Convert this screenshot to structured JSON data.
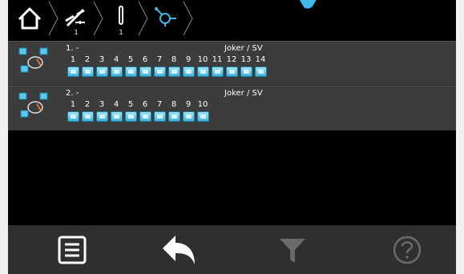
{
  "breadcrumb": {
    "items": [
      {
        "icon": "home-icon",
        "sub": ""
      },
      {
        "icon": "disconnect-icon",
        "sub": "1"
      },
      {
        "icon": "sensor-probe-icon",
        "sub": "1"
      },
      {
        "icon": "network-node-icon",
        "sub": ""
      }
    ]
  },
  "groups": [
    {
      "title": "1. -",
      "owner": "Joker / SV",
      "numbers": [
        "1",
        "2",
        "3",
        "4",
        "5",
        "6",
        "7",
        "8",
        "9",
        "10",
        "11",
        "12",
        "13",
        "14"
      ]
    },
    {
      "title": "2. -",
      "owner": "Joker / SV",
      "numbers": [
        "1",
        "2",
        "3",
        "4",
        "5",
        "6",
        "7",
        "8",
        "9",
        "10"
      ]
    }
  ],
  "toolbar": {
    "items": [
      {
        "icon": "list-icon",
        "enabled": true
      },
      {
        "icon": "back-arrow-icon",
        "enabled": true
      },
      {
        "icon": "filter-icon",
        "enabled": false
      },
      {
        "icon": "help-icon",
        "enabled": false
      }
    ]
  },
  "colors": {
    "accent": "#3db8e8",
    "row_bg": "#3c3c3c",
    "toolbar_bg": "#2f2f2f",
    "disabled": "#6a6a6a"
  }
}
